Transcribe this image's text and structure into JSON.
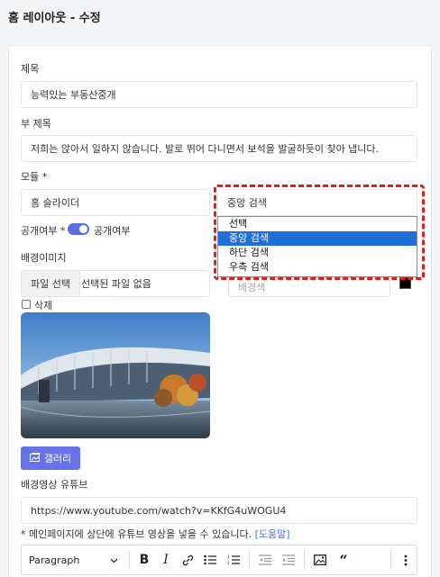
{
  "page": {
    "title": "홈 레이아웃 - 수정"
  },
  "form": {
    "title_label": "제목",
    "title_value": "능력있는 부동산중개",
    "subtitle_label": "부 제목",
    "subtitle_value": "저희는 앉아서 일하지 않습니다. 발로 뛰어 다니면서 보석을 발굴하듯이 찾아 냅니다.",
    "module_label": "모듈 *",
    "module_value": "홈 슬라이더",
    "search_select_value": "중앙 검색",
    "search_options": [
      "선택",
      "중앙 검색",
      "하단 검색",
      "우측 검색"
    ],
    "search_selected_index": 1,
    "public_label": "공개여부 *",
    "public_toggle_text": "공개여부",
    "public_on": true,
    "bg_image_label": "배경이미지",
    "file_button": "파일 선택",
    "file_status": "선택된 파일 없음",
    "bg_color_placeholder": "배경색",
    "bg_color_value": "#000000",
    "delete_label": "삭제",
    "gallery_button": "갤러리",
    "bg_video_label": "배경영상 유튜브",
    "youtube_value": "https://www.youtube.com/watch?v=KKfG4uWOGU4",
    "note_text": "* 메인페이지에 상단에 유튜브 영상을 넣을 수 있습니다.",
    "help_link": "[도움말]"
  },
  "editor": {
    "paragraph_select": "Paragraph",
    "tools": [
      "bold-icon",
      "italic-icon",
      "link-icon",
      "bulleted-list-icon",
      "numbered-list-icon",
      "outdent-icon",
      "indent-icon",
      "image-icon",
      "quote-icon",
      "more-icon"
    ]
  },
  "colors": {
    "accent": "#6672e8",
    "selected_option": "#1e6fd9",
    "highlight": "#e01e1e"
  }
}
